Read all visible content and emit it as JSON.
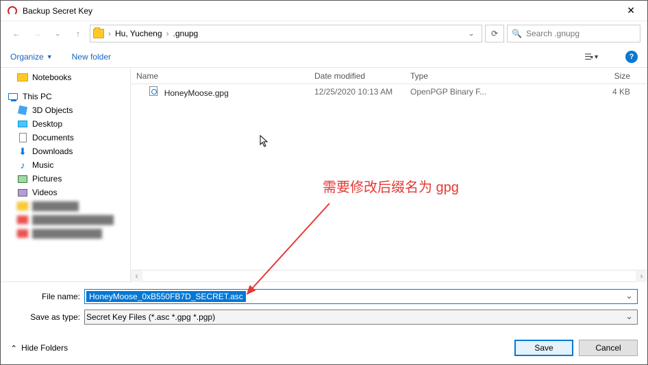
{
  "window": {
    "title": "Backup Secret Key"
  },
  "nav": {
    "crumbs": [
      "Hu, Yucheng",
      ".gnupg"
    ],
    "search_placeholder": "Search .gnupg"
  },
  "toolbar": {
    "organize": "Organize",
    "new_folder": "New folder"
  },
  "tree": {
    "notebooks": "Notebooks",
    "this_pc": "This PC",
    "objects3d": "3D Objects",
    "desktop": "Desktop",
    "documents": "Documents",
    "downloads": "Downloads",
    "music": "Music",
    "pictures": "Pictures",
    "videos": "Videos"
  },
  "columns": {
    "name": "Name",
    "date": "Date modified",
    "type": "Type",
    "size": "Size"
  },
  "files": [
    {
      "name": "HoneyMoose.gpg",
      "date": "12/25/2020 10:13 AM",
      "type": "OpenPGP Binary F...",
      "size": "4 KB"
    }
  ],
  "form": {
    "filename_label": "File name:",
    "filename_value": "HoneyMoose_0xB550FB7D_SECRET.asc",
    "type_label": "Save as type:",
    "type_value": "Secret Key Files (*.asc *.gpg *.pgp)"
  },
  "footer": {
    "hide_folders": "Hide Folders",
    "save": "Save",
    "cancel": "Cancel"
  },
  "annotation": {
    "text": "需要修改后缀名为 gpg"
  }
}
